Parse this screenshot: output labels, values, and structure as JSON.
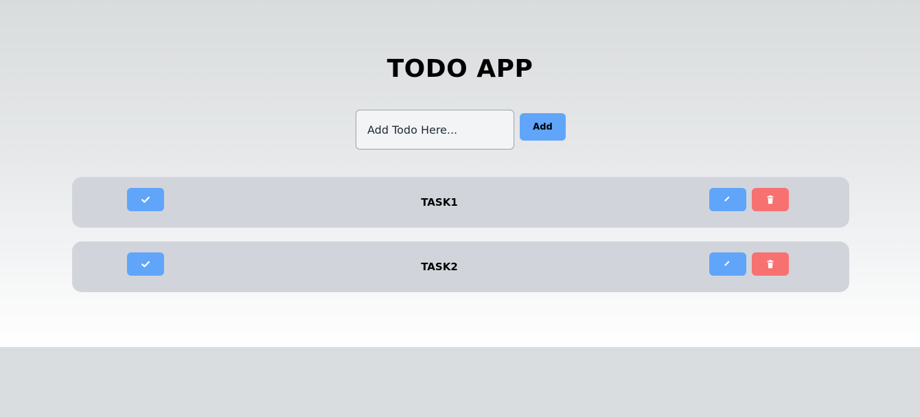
{
  "header": {
    "title": "TODO APP"
  },
  "input": {
    "placeholder": "Add Todo Here...",
    "value": ""
  },
  "add_button": {
    "label": "Add"
  },
  "tasks": [
    {
      "label": "TASK1"
    },
    {
      "label": "TASK2"
    }
  ],
  "icons": {
    "complete": "check-icon",
    "edit": "pencil-icon",
    "delete": "trash-icon"
  },
  "colors": {
    "primary": "#60a5fa",
    "danger": "#f87171",
    "row": "#d1d5db"
  }
}
